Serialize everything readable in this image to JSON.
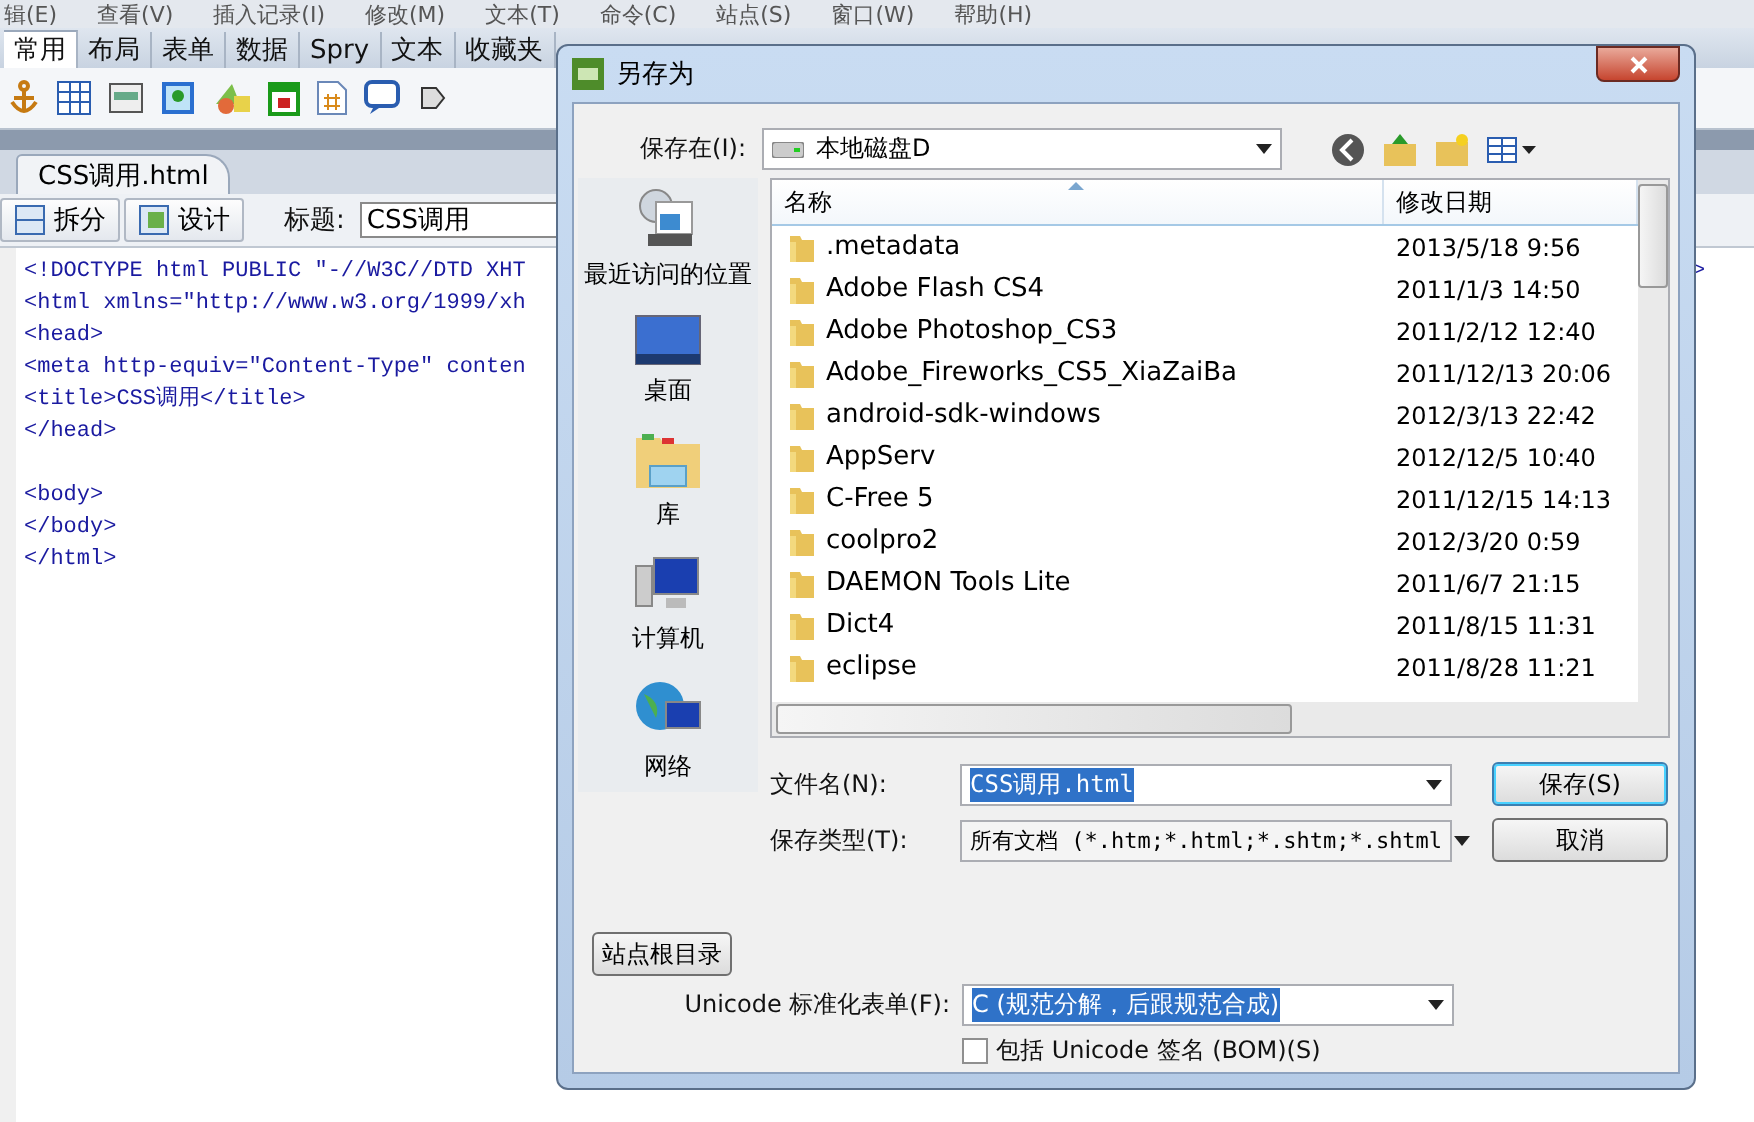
{
  "menu_bar": [
    "辑(E)",
    "查看(V)",
    "插入记录(I)",
    "修改(M)",
    "文本(T)",
    "命令(C)",
    "站点(S)",
    "窗口(W)",
    "帮助(H)"
  ],
  "insert_tabs": [
    {
      "label": "常用",
      "selected": true
    },
    {
      "label": "布局",
      "selected": false
    },
    {
      "label": "表单",
      "selected": false
    },
    {
      "label": "数据",
      "selected": false
    },
    {
      "label": "Spry",
      "selected": false
    },
    {
      "label": "文本",
      "selected": false
    },
    {
      "label": "收藏夹",
      "selected": false
    }
  ],
  "document_tab": {
    "label": "CSS调用.html",
    "selected": true
  },
  "view_buttons": [
    {
      "label": "拆分"
    },
    {
      "label": "设计"
    }
  ],
  "title_field": {
    "label": "标题:",
    "value": "CSS调用"
  },
  "head_lines": [
    "<!DOCTYPE html PUBLIC \"-//W3C//DTD XHT",
    "<html xmlns=\"http://www.w3.org/1999/xh",
    "<head>",
    "<meta http-equiv=\"Content-Type\" conten",
    "<title>CSS调用</title>",
    "</head>"
  ],
  "body_lines": [
    "<body>",
    "</body>",
    "</html>"
  ],
  "code_tail": ">",
  "dialog": {
    "title": "另存为",
    "save_in": {
      "label": "保存在(I):",
      "value": "本地磁盘D"
    },
    "places": [
      {
        "label": "最近访问的位置",
        "kind": "recent"
      },
      {
        "label": "桌面",
        "kind": "desktop"
      },
      {
        "label": "库",
        "kind": "library"
      },
      {
        "label": "计算机",
        "kind": "computer"
      },
      {
        "label": "网络",
        "kind": "network"
      }
    ],
    "columns": [
      "名称",
      "修改日期"
    ],
    "files": [
      {
        "name": ".metadata",
        "date": "2013/5/18 9:56"
      },
      {
        "name": "Adobe Flash CS4",
        "date": "2011/1/3 14:50"
      },
      {
        "name": "Adobe Photoshop_CS3",
        "date": "2011/2/12 12:40"
      },
      {
        "name": "Adobe_Fireworks_CS5_XiaZaiBa",
        "date": "2011/12/13 20:06"
      },
      {
        "name": "android-sdk-windows",
        "date": "2012/3/13 22:42"
      },
      {
        "name": "AppServ",
        "date": "2012/12/5 10:40"
      },
      {
        "name": "C-Free 5",
        "date": "2011/12/15 14:13"
      },
      {
        "name": "coolpro2",
        "date": "2012/3/20 0:59"
      },
      {
        "name": "DAEMON Tools Lite",
        "date": "2011/6/7 21:15"
      },
      {
        "name": "Dict4",
        "date": "2011/8/15 11:31"
      },
      {
        "name": "eclipse",
        "date": "2011/8/28 11:21"
      }
    ],
    "file_name": {
      "label": "文件名(N):",
      "value": "CSS调用.html"
    },
    "file_type": {
      "label": "保存类型(T):",
      "value": "所有文档 (*.htm;*.html;*.shtm;*.shtml"
    },
    "save_button": "保存(S)",
    "cancel_button": "取消",
    "site_root_button": "站点根目录",
    "unicode_form": {
      "label": "Unicode 标准化表单(F):",
      "value": "C (规范分解，后跟规范合成)"
    },
    "bom_checkbox": {
      "label": "包括 Unicode 签名 (BOM)(S)",
      "checked": false
    }
  }
}
